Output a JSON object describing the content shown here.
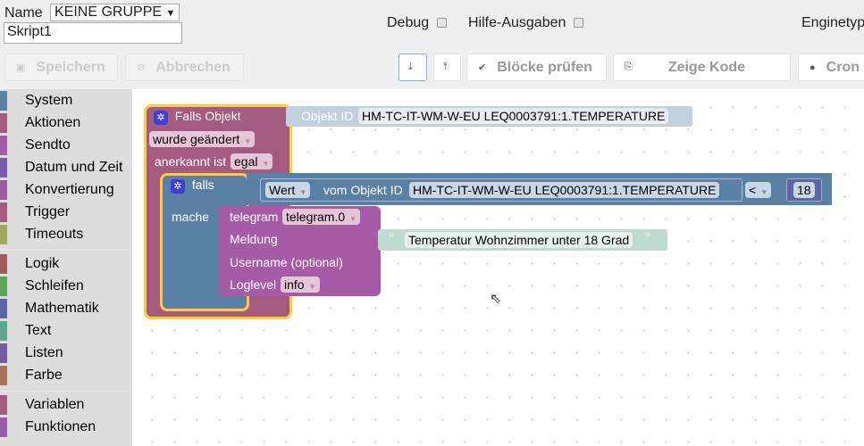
{
  "header": {
    "name_label": "Name",
    "group_select": "KEINE GRUPPE",
    "script_name": "Skript1",
    "debug_label": "Debug",
    "help_label": "Hilfe-Ausgaben",
    "engine_label": "Enginetyp"
  },
  "toolbar": {
    "save": "Speichern",
    "cancel": "Abbrechen",
    "check": "Blöcke prüfen",
    "show_code": "Zeige Kode",
    "cron": "Cron"
  },
  "sidebar": {
    "items": [
      {
        "label": "System",
        "color": "#5b80a5"
      },
      {
        "label": "Aktionen",
        "color": "#a55b80"
      },
      {
        "label": "Sendto",
        "color": "#a55ba5"
      },
      {
        "label": "Datum und Zeit",
        "color": "#7b5ba5"
      },
      {
        "label": "Konvertierung",
        "color": "#995ba5"
      },
      {
        "label": "Trigger",
        "color": "#a55b80"
      },
      {
        "label": "Timeouts",
        "color": "#a5a55b"
      },
      {
        "label": "Logik",
        "color": "#a55b5b"
      },
      {
        "label": "Schleifen",
        "color": "#5ba55b"
      },
      {
        "label": "Mathematik",
        "color": "#5b67a5"
      },
      {
        "label": "Text",
        "color": "#5ba58c"
      },
      {
        "label": "Listen",
        "color": "#745ba5"
      },
      {
        "label": "Farbe",
        "color": "#a5745b"
      },
      {
        "label": "Variablen",
        "color": "#a55b80"
      },
      {
        "label": "Funktionen",
        "color": "#995ba5"
      }
    ]
  },
  "blocks": {
    "trigger": {
      "title": "Falls Objekt",
      "event": "wurde geändert",
      "ack_label": "anerkannt ist",
      "ack": "egal",
      "oid_label": "Objekt ID",
      "oid": "HM-TC-IT-WM-W-EU LEQ0003791:1.TEMPERATURE"
    },
    "if": {
      "label": "falls",
      "do_label": "mache",
      "value_sel": "Wert",
      "from_label": "vom Objekt ID",
      "oid": "HM-TC-IT-WM-W-EU LEQ0003791:1.TEMPERATURE",
      "op": "<",
      "number": "18"
    },
    "telegram": {
      "label": "telegram",
      "instance": "telegram.0",
      "message_label": "Meldung",
      "user_label": "Username (optional)",
      "loglevel_label": "Loglevel",
      "loglevel": "info",
      "message": "Temperatur Wohnzimmer unter 18 Grad"
    }
  }
}
